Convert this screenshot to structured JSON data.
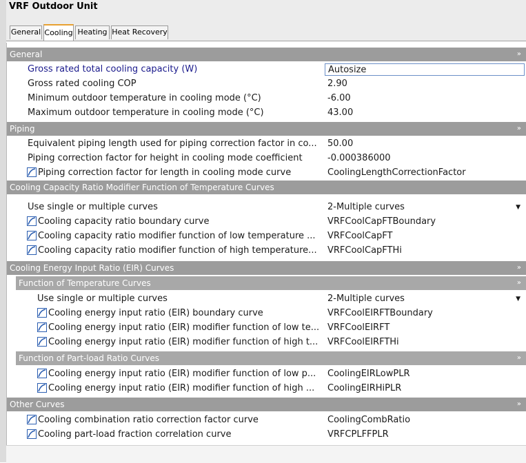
{
  "window": {
    "title": "VRF Outdoor Unit"
  },
  "tabs": [
    {
      "label": "General",
      "active": false
    },
    {
      "label": "Cooling",
      "active": true
    },
    {
      "label": "Heating",
      "active": false
    },
    {
      "label": "Heat Recovery",
      "active": false
    }
  ],
  "sections": {
    "general": "General",
    "piping": "Piping",
    "cap_ratio": "Cooling Capacity Ratio Modifier Function of Temperature Curves",
    "eir": "Cooling Energy Input Ratio (EIR) Curves",
    "eir_temp": "Function of Temperature Curves",
    "eir_plr": "Function of Part-load Ratio Curves",
    "other": "Other Curves"
  },
  "rows": [
    {
      "label": "Gross rated total cooling capacity (W)",
      "value": "Autosize"
    },
    {
      "label": "Gross rated cooling COP",
      "value": "2.90"
    },
    {
      "label": "Minimum outdoor temperature in cooling mode (°C)",
      "value": "-6.00"
    },
    {
      "label": "Maximum outdoor temperature in cooling mode (°C)",
      "value": "43.00"
    },
    {
      "label": "Equivalent piping length used for piping correction factor in co...",
      "value": "50.00"
    },
    {
      "label": "Piping correction factor for height in cooling mode coefficient",
      "value": "-0.000386000"
    },
    {
      "label": "Piping correction factor for length in cooling mode curve",
      "value": "CoolingLengthCorrectionFactor"
    },
    {
      "label": "Use single or multiple curves",
      "value": "2-Multiple curves"
    },
    {
      "label": "Cooling capacity ratio boundary curve",
      "value": "VRFCoolCapFTBoundary"
    },
    {
      "label": "Cooling capacity ratio modifier function of low temperature ...",
      "value": "VRFCoolCapFT"
    },
    {
      "label": "Cooling capacity ratio modifier function of high temperature...",
      "value": "VRFCoolCapFTHi"
    },
    {
      "label": "Use single or multiple curves",
      "value": "2-Multiple curves"
    },
    {
      "label": "Cooling energy input ratio (EIR) boundary curve",
      "value": "VRFCoolEIRFTBoundary"
    },
    {
      "label": "Cooling energy input ratio (EIR) modifier function of low te...",
      "value": "VRFCoolEIRFT"
    },
    {
      "label": "Cooling energy input ratio (EIR) modifier function of high t...",
      "value": "VRFCoolEIRFTHi"
    },
    {
      "label": "Cooling energy input ratio (EIR) modifier function of low p...",
      "value": "CoolingEIRLowPLR"
    },
    {
      "label": "Cooling energy input ratio (EIR) modifier function of high ...",
      "value": "CoolingEIRHiPLR"
    },
    {
      "label": "Cooling combination ratio correction factor curve",
      "value": "CoolingCombRatio"
    },
    {
      "label": "Cooling part-load fraction correlation curve",
      "value": "VRFCPLFFPLR"
    }
  ],
  "icons": {
    "curve": "curve-icon",
    "collapse": "collapse-chevron-icon",
    "dropdown": "dropdown-arrow-icon"
  },
  "colors": {
    "section_header": "#9c9c9c",
    "active_tab_accent": "#e8a030",
    "selected_label": "#1a1a8c",
    "curve_icon": "#2a5db0"
  }
}
